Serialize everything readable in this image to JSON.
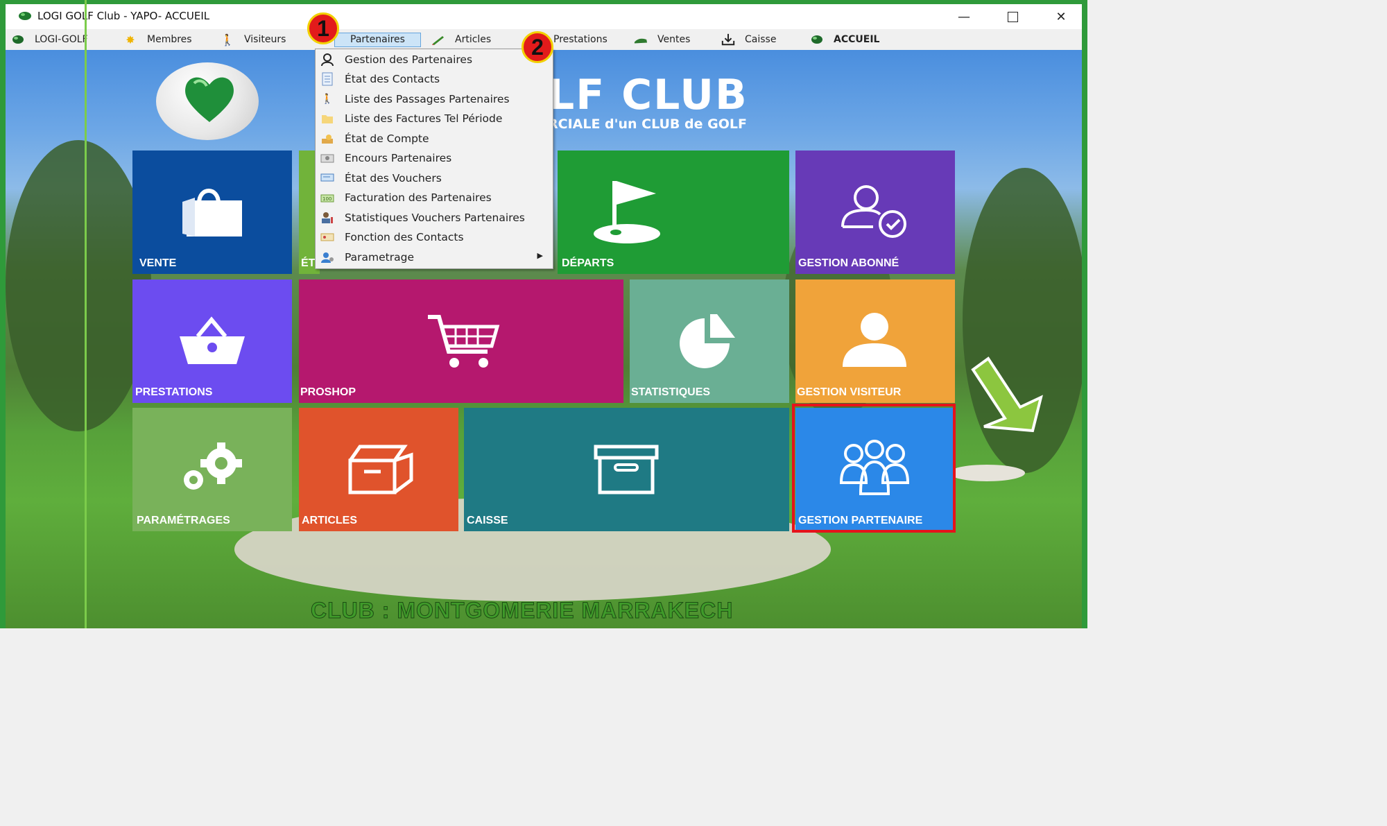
{
  "window": {
    "title": "LOGI GOLF Club - YAPO- ACCUEIL",
    "minimize_icon": "minimize-icon",
    "maximize_icon": "maximize-icon",
    "close_icon": "close-icon"
  },
  "menubar": {
    "items": [
      {
        "label": "LOGI-GOLF",
        "icon": "golf-ball-icon"
      },
      {
        "label": "Membres",
        "icon": "sun-icon"
      },
      {
        "label": "Visiteurs",
        "icon": "walker-icon"
      },
      {
        "label": "Partenaires",
        "icon": "",
        "active": true
      },
      {
        "label": "Articles",
        "icon": "pencil-icon"
      },
      {
        "label": "Prestations",
        "icon": ""
      },
      {
        "label": "Ventes",
        "icon": "golf-shoe-icon"
      },
      {
        "label": "Caisse",
        "icon": "download-icon"
      },
      {
        "label": "ACCUEIL",
        "icon": "golf-ball-icon"
      }
    ]
  },
  "dropdown": {
    "items": [
      {
        "label": "Gestion des Partenaires",
        "icon": "partner-icon"
      },
      {
        "label": "État des Contacts",
        "icon": "document-icon"
      },
      {
        "label": "Liste des Passages Partenaires",
        "icon": "walker-icon"
      },
      {
        "label": "Liste des Factures Tel Période",
        "icon": "folder-icon"
      },
      {
        "label": "État de Compte",
        "icon": "hand-money-icon"
      },
      {
        "label": "Encours Partenaires",
        "icon": "money-icon"
      },
      {
        "label": "État des Vouchers",
        "icon": "voucher-icon"
      },
      {
        "label": "Facturation des Partenaires",
        "icon": "bill-icon"
      },
      {
        "label": "Statistiques Vouchers Partenaires",
        "icon": "person-chart-icon"
      },
      {
        "label": "Fonction des Contacts",
        "icon": "card-icon"
      },
      {
        "label": "Parametrage",
        "icon": "settings-user-icon",
        "submenu": true
      }
    ]
  },
  "brand": {
    "title": "LF CLUB",
    "subtitle": "RCIALE d'un CLUB de GOLF"
  },
  "tiles": {
    "vente": "VENTE",
    "etat": "ÉT",
    "departs": "DÉPARTS",
    "gestion_abonne": "GESTION ABONNÉ",
    "prestations": "PRESTATIONS",
    "proshop": "PROSHOP",
    "statistiques": "STATISTIQUES",
    "gestion_visiteur": "GESTION VISITEUR",
    "parametrages": "PARAMÉTRAGES",
    "articles": "ARTICLES",
    "caisse": "CAISSE",
    "gestion_partenaire": "GESTION PARTENAIRE"
  },
  "badges": {
    "one": "1",
    "two": "2"
  },
  "footer": {
    "club": "CLUB : MONTGOMERIE MARRAKECH"
  },
  "colors": {
    "vente": "#0b4d9e",
    "etat": "#71b33a",
    "departs": "#1f9c35",
    "gestion_abonne": "#673ab7",
    "prestations": "#6c4cf0",
    "proshop": "#b5186e",
    "statistiques": "#6aaf94",
    "gestion_visiteur": "#f0a33a",
    "parametrages": "#79b25a",
    "articles": "#e0532c",
    "caisse": "#1f7a84",
    "gestion_partenaire": "#2b88e8",
    "highlight": "#e5131b",
    "arrow": "#8cc63f"
  }
}
